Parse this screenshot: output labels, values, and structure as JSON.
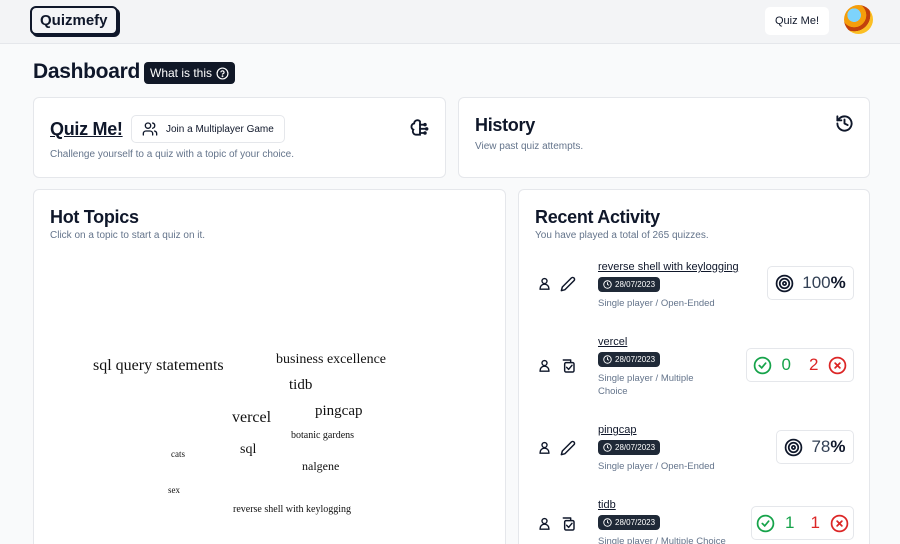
{
  "nav": {
    "logo": "Quizmefy",
    "quiz_button": "Quiz Me!"
  },
  "page": {
    "title": "Dashboard",
    "what_is_this": "What is this"
  },
  "quiz_me_card": {
    "title": "Quiz Me!",
    "join_button": "Join a Multiplayer Game",
    "subtitle": "Challenge yourself to a quiz with a topic of your choice."
  },
  "history_card": {
    "title": "History",
    "subtitle": "View past quiz attempts."
  },
  "hot_topics": {
    "title": "Hot Topics",
    "subtitle": "Click on a topic to start a quiz on it.",
    "words": [
      {
        "text": "sql query statements"
      },
      {
        "text": "business excellence"
      },
      {
        "text": "tidb"
      },
      {
        "text": "pingcap"
      },
      {
        "text": "vercel"
      },
      {
        "text": "botanic gardens"
      },
      {
        "text": "sql"
      },
      {
        "text": "cats"
      },
      {
        "text": "nalgene"
      },
      {
        "text": "sex"
      },
      {
        "text": "reverse shell with keylogging"
      }
    ]
  },
  "recent_activity": {
    "title": "Recent Activity",
    "subtitle": "You have played a total of 265 quizzes.",
    "items": [
      {
        "topic": "reverse shell with keylogging",
        "date": "28/07/2023",
        "type": "Single player / Open-Ended",
        "mode_icon": "pencil-icon",
        "score_kind": "percent",
        "percent": "100"
      },
      {
        "topic": "vercel",
        "date": "28/07/2023",
        "type": "Single player / Multiple Choice",
        "mode_icon": "checkbox-icon",
        "score_kind": "correct-wrong",
        "correct": "0",
        "wrong": "2"
      },
      {
        "topic": "pingcap",
        "date": "28/07/2023",
        "type": "Single player / Open-Ended",
        "mode_icon": "pencil-icon",
        "score_kind": "percent",
        "percent": "78"
      },
      {
        "topic": "tidb",
        "date": "28/07/2023",
        "type": "Single player / Multiple Choice",
        "mode_icon": "checkbox-icon",
        "score_kind": "correct-wrong",
        "correct": "1",
        "wrong": "1"
      }
    ]
  },
  "colors": {
    "correct": "#16a34a",
    "wrong": "#dc2626",
    "badge_bg": "#1f2937"
  }
}
